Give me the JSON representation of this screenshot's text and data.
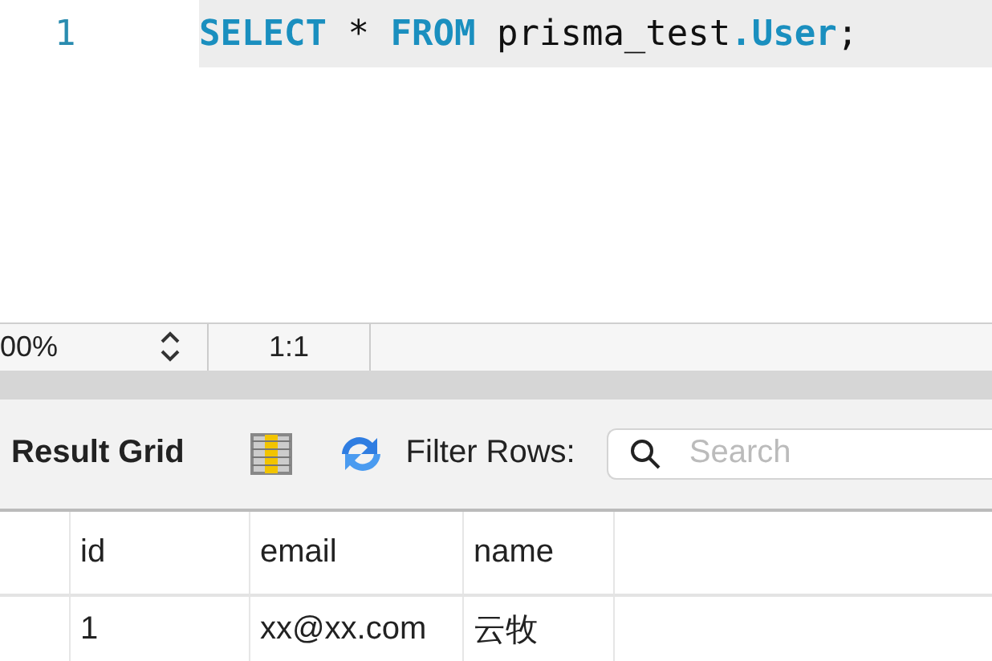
{
  "editor": {
    "lines": [
      {
        "number": "1",
        "current": true,
        "tokens": [
          {
            "kind": "keyword",
            "text": "SELECT"
          },
          {
            "kind": "plain",
            "text": " * "
          },
          {
            "kind": "keyword",
            "text": "FROM"
          },
          {
            "kind": "plain",
            "text": " prisma_test"
          },
          {
            "kind": "keyword",
            "text": ".User"
          },
          {
            "kind": "plain",
            "text": ";"
          }
        ]
      }
    ]
  },
  "status_bar": {
    "zoom": "00%",
    "position": "1:1"
  },
  "toolbar": {
    "title": "Result Grid",
    "filter_label": "Filter Rows:",
    "search": {
      "placeholder": "Search"
    }
  },
  "table": {
    "columns": [
      "id",
      "email",
      "name"
    ],
    "rows": [
      [
        "1",
        "xx@xx.com",
        "云牧"
      ]
    ]
  }
}
